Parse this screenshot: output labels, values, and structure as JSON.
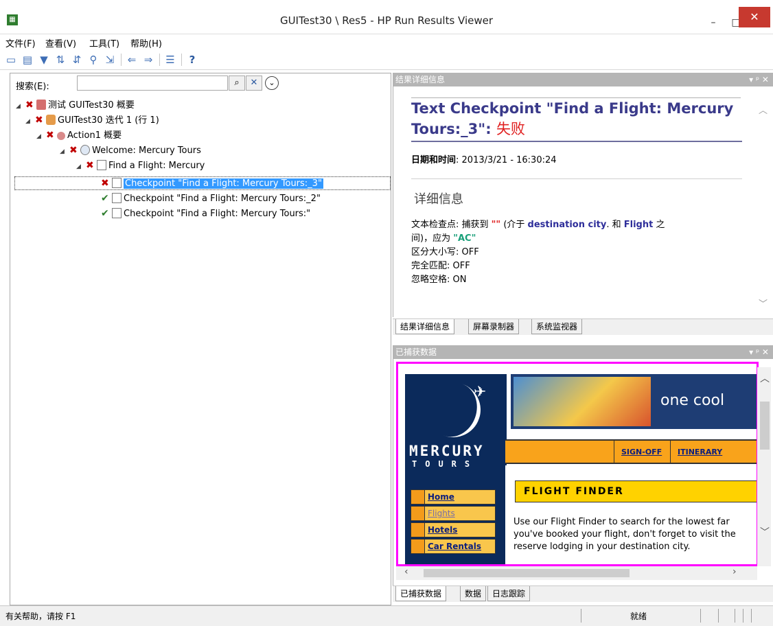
{
  "window": {
    "title": "GUITest30 \\ Res5 - HP Run Results Viewer",
    "minimize_glyph": "–",
    "maximize_glyph": "□",
    "close_glyph": "✕"
  },
  "menu": [
    "文件(F)",
    "查看(V)",
    "工具(T)",
    "帮助(H)"
  ],
  "toolbar": {
    "icons": [
      "open-icon",
      "print-icon",
      "filter-icon",
      "expand-icon",
      "collapse-icon",
      "find-icon",
      "export-icon",
      "back-icon",
      "forward-icon",
      "list-icon",
      "help-icon"
    ]
  },
  "search": {
    "label": "搜索(E):",
    "value": "",
    "go_glyph": "⌕",
    "clear_glyph": "✕",
    "more_glyph": "⌄"
  },
  "tree": {
    "nodes": [
      {
        "label": "测试 GUITest30 概要",
        "status": "fail"
      },
      {
        "label": "GUITest30 迭代 1 (行 1)",
        "status": "fail"
      },
      {
        "label": "Action1 概要",
        "status": "fail"
      },
      {
        "label": "Welcome: Mercury Tours",
        "status": "fail"
      },
      {
        "label": "Find a Flight: Mercury",
        "status": "fail"
      },
      {
        "label": "Checkpoint \"Find a Flight: Mercury Tours:_3\"",
        "status": "fail",
        "selected": true
      },
      {
        "label": "Checkpoint \"Find a Flight: Mercury Tours:_2\"",
        "status": "pass"
      },
      {
        "label": "Checkpoint \"Find a Flight: Mercury Tours:\"",
        "status": "pass"
      }
    ],
    "fail_glyph": "✖",
    "pass_glyph": "✔",
    "expand_glyph": "◢"
  },
  "result_details": {
    "header": "结果详细信息",
    "pane_controls": "▾ ᵖ ✕",
    "title": "Text Checkpoint \"Find a Flight: Mercury Tours:_3\": ",
    "status_text": "失败",
    "date_label": "日期和时间",
    "date_value": ": 2013/3/21 - 16:30:24",
    "section_title": "详细信息",
    "detail": {
      "line1_a": "文本检查点: 捕获到 ",
      "captured": "\"\"",
      "line1_b": " (介于  ",
      "between1": "destination city",
      "line1_c": ". 和  ",
      "between2": "Flight",
      "line1_d": " 之",
      "line2_a": "间)，应为 ",
      "expected": "\"AC\"",
      "line3": "区分大小写: OFF",
      "line4": "完全匹配: OFF",
      "line5": "忽略空格: ON"
    },
    "tabs": [
      "结果详细信息",
      "屏幕录制器",
      "系统监视器"
    ]
  },
  "captured_data": {
    "header": "已捕获数据",
    "pane_controls": "▾ ᵖ ✕",
    "site": {
      "brand_top": "MERCURY",
      "brand_bottom": "TOURS",
      "banner_text": "one cool",
      "nav_tabs": [
        "SIGN-OFF",
        "ITINERARY"
      ],
      "left_nav": [
        "Home",
        "Flights",
        "Hotels",
        "Car Rentals"
      ],
      "finder_title": "FLIGHT FINDER",
      "desc_lines": [
        "Use our Flight Finder to search for the lowest far",
        "you've booked your flight, don't forget to visit the",
        "reserve lodging in your destination city."
      ]
    },
    "tabs": [
      "已捕获数据",
      "数据",
      "日志跟踪"
    ]
  },
  "status": {
    "help": "有关帮助，请按 F1",
    "ready": "就绪"
  }
}
